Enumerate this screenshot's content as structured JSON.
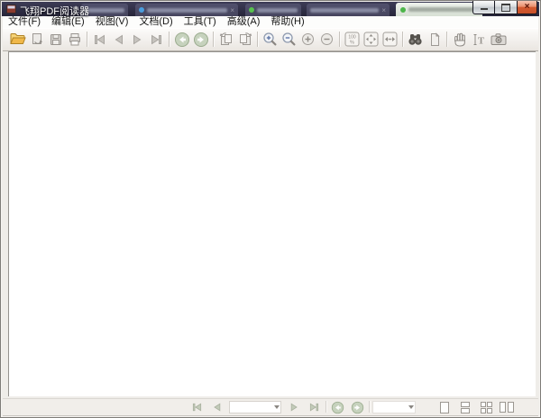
{
  "titlebar": {
    "title": "飞翔PDF阅读器"
  },
  "menubar": {
    "items": [
      {
        "label": "文件(F)"
      },
      {
        "label": "编辑(E)"
      },
      {
        "label": "视图(V)"
      },
      {
        "label": "文档(D)"
      },
      {
        "label": "工具(T)"
      },
      {
        "label": "高级(A)"
      },
      {
        "label": "帮助(H)"
      }
    ]
  },
  "toolbar": {
    "buttons": [
      {
        "name": "open",
        "icon": "folder-open-icon",
        "enabled": true
      },
      {
        "name": "save-copy",
        "icon": "page-export-icon",
        "enabled": false
      },
      {
        "name": "save",
        "icon": "save-icon",
        "enabled": false
      },
      {
        "name": "print",
        "icon": "print-icon",
        "enabled": false
      },
      {
        "name": "first-page",
        "icon": "first-page-icon",
        "enabled": false
      },
      {
        "name": "previous-page",
        "icon": "previous-page-icon",
        "enabled": false
      },
      {
        "name": "next-page",
        "icon": "next-page-icon",
        "enabled": false
      },
      {
        "name": "last-page",
        "icon": "last-page-icon",
        "enabled": false
      },
      {
        "name": "go-back",
        "icon": "back-circle-icon",
        "enabled": false
      },
      {
        "name": "go-forward",
        "icon": "forward-circle-icon",
        "enabled": false
      },
      {
        "name": "rotate-left",
        "icon": "rotate-left-icon",
        "enabled": false
      },
      {
        "name": "rotate-right",
        "icon": "rotate-right-icon",
        "enabled": false
      },
      {
        "name": "zoom-in-tool",
        "icon": "magnifier-plus-icon",
        "enabled": false
      },
      {
        "name": "zoom-out-tool",
        "icon": "magnifier-minus-icon",
        "enabled": false
      },
      {
        "name": "zoom-in",
        "icon": "circle-plus-icon",
        "enabled": false
      },
      {
        "name": "zoom-out",
        "icon": "circle-minus-icon",
        "enabled": false
      },
      {
        "name": "actual-size",
        "icon": "actual-size-icon",
        "enabled": false
      },
      {
        "name": "fit-page",
        "icon": "fit-page-icon",
        "enabled": false
      },
      {
        "name": "fit-width",
        "icon": "fit-width-icon",
        "enabled": false
      },
      {
        "name": "find",
        "icon": "binoculars-icon",
        "enabled": true
      },
      {
        "name": "bookmark",
        "icon": "page-icon",
        "enabled": false
      },
      {
        "name": "hand-tool",
        "icon": "hand-icon",
        "enabled": false
      },
      {
        "name": "text-select",
        "icon": "text-select-icon",
        "enabled": false
      },
      {
        "name": "snapshot",
        "icon": "camera-icon",
        "enabled": false
      }
    ],
    "actual_size": {
      "line1": "100",
      "line2": "%"
    }
  },
  "statusbar": {
    "page_combo": {
      "value": ""
    },
    "zoom_combo": {
      "value": ""
    },
    "buttons": [
      {
        "name": "first-page"
      },
      {
        "name": "previous-page"
      },
      {
        "name": "next-page"
      },
      {
        "name": "last-page"
      },
      {
        "name": "go-back"
      },
      {
        "name": "go-forward"
      },
      {
        "name": "single-page-view"
      },
      {
        "name": "continuous-view"
      },
      {
        "name": "facing-view"
      },
      {
        "name": "two-up-view"
      }
    ]
  },
  "colors": {
    "titlebar_dark": "#2e2d45",
    "close_button": "#d35a31",
    "light_tab": "#dfe6dc",
    "toolbar_top": "#fdfcfb",
    "toolbar_bottom": "#eae6e1",
    "statusbar_bg": "#f1eeea",
    "folder_yellow": "#f0b84a",
    "nav_green_circle": "#c6d2bd",
    "doc_bg": "#ffffff"
  }
}
